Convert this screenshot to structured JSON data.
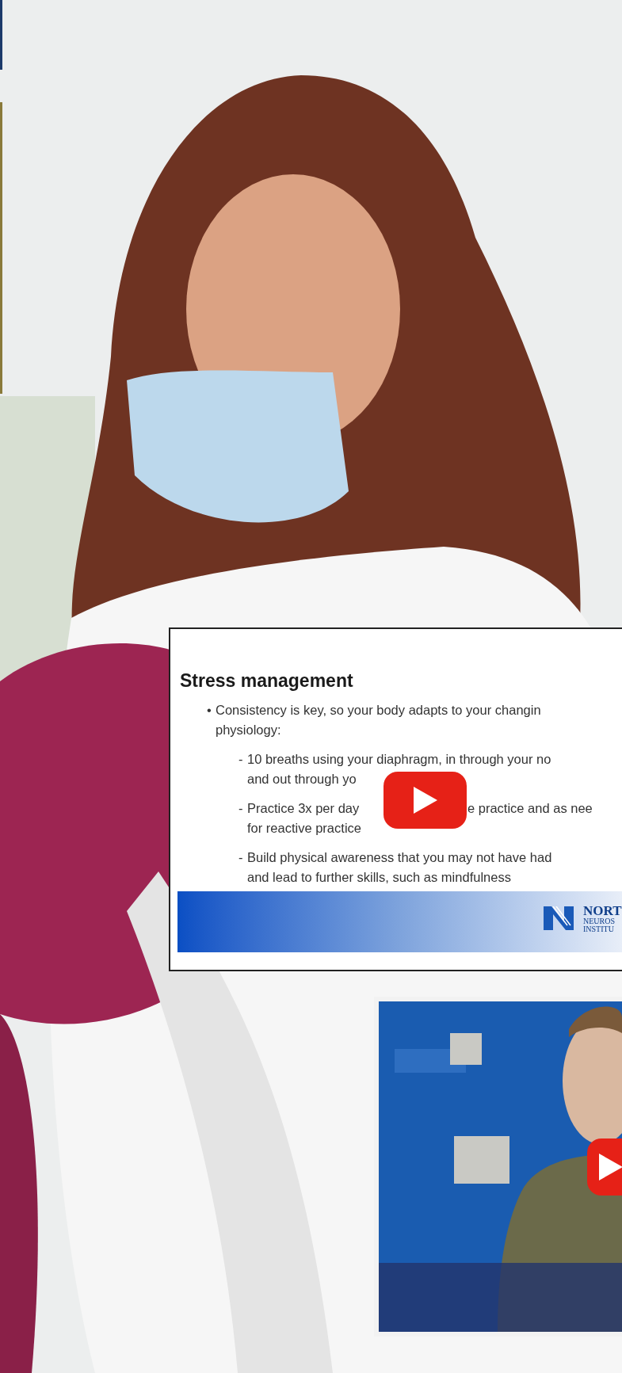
{
  "background": {
    "kind": "picture"
  },
  "videos": [
    {
      "kind": "slide",
      "slide": {
        "title": "Stress management",
        "bullets": [
          {
            "kind": "main",
            "marker": "•",
            "lines": [
              [
                "Consistency is key, so your body adapts to your changin"
              ],
              [
                "physiology:"
              ]
            ]
          },
          {
            "kind": "sub",
            "marker": "-",
            "lines": [
              [
                "10 breaths using your diaphragm, in through your no"
              ],
              [
                "and out through yo"
              ]
            ]
          },
          {
            "kind": "sub",
            "marker": "-",
            "lines": [
              [
                "Practice 3x per day",
                "e practice and as nee"
              ],
              [
                "for reactive practice"
              ]
            ]
          },
          {
            "kind": "sub",
            "marker": "-",
            "lines": [
              [
                "Build physical awareness that you may not have had"
              ],
              [
                "and lead to further skills, such as mindfulness"
              ]
            ]
          }
        ],
        "logo": [
          "NORT",
          "NEUROS",
          "INSTITU"
        ]
      }
    },
    {
      "kind": "picture"
    }
  ]
}
